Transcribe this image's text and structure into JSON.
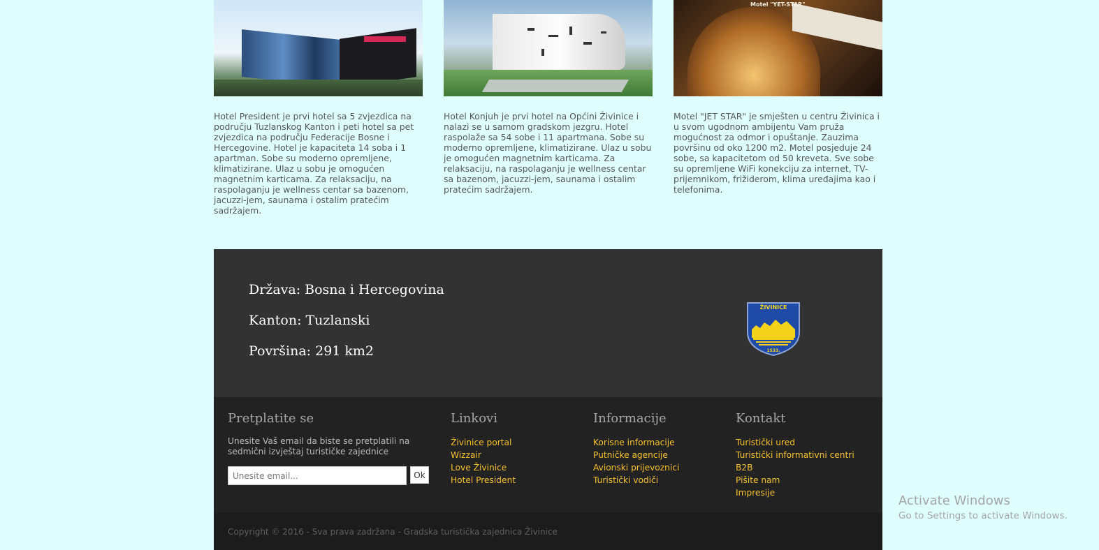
{
  "hotels": [
    {
      "image_alt": "Hotel President",
      "description": "Hotel President je prvi hotel sa 5 zvjezdica na području Tuzlanskog Kanton i peti hotel sa pet zvjezdica na području Federacije Bosne i Hercegovine. Hotel je kapaciteta 14 soba i 1 apartman. Sobe su moderno opremljene, klimatizirane. Ulaz u sobu je omogućen magnetnim karticama. Za relaksaciju, na raspolaganju je wellness centar sa bazenom, jacuzzi-jem, saunama i ostalim pratećim sadržajem."
    },
    {
      "image_alt": "Hotel Konjuh",
      "description": "Hotel Konjuh je prvi hotel na Općini Živinice i nalazi se u samom gradskom jezgru. Hotel raspolaže sa 54 sobe i 11 apartmana. Sobe su moderno opremljene, klimatizirane. Ulaz u sobu je omogućen magnetnim karticama. Za relaksaciju, na raspolaganju je wellness centar sa bazenom, jacuzzi-jem, saunama i ostalim pratećim sadržajem."
    },
    {
      "image_alt": "Motel Jet Star",
      "image_sign": "Motel \"YET-STAR\"",
      "description": "Motel \"JET STAR\" je smješten u centru Živinica i u svom ugodnom ambijentu Vam pruža mogućnost za odmor i opuštanje. Zauzima površinu od oko 1200 m2. Motel posjeduje 24 sobe, sa kapacitetom od 50 kreveta. Sve sobe su opremljene WiFi konekciju za internet, TV-prijemnikom, frižiderom, klima uređajima kao i telefonima."
    }
  ],
  "info": {
    "country": "Država: Bosna i Hercegovina",
    "canton": "Kanton: Tuzlanski",
    "area": "Površina: 291 km2",
    "crest_title": "ŽIVINICE",
    "crest_year": "1533."
  },
  "footer": {
    "subscribe": {
      "title": "Pretplatite se",
      "description": "Unesite Vaš email da biste se pretplatili na sedmični izvještaj turističke zajednice",
      "email_placeholder": "Unesite email...",
      "button_label": "Ok"
    },
    "links": {
      "title": "Linkovi",
      "items": [
        "Živinice portal",
        "Wizzair",
        "Love Živinice",
        "Hotel President"
      ]
    },
    "information": {
      "title": "Informacije",
      "items": [
        "Korisne informacije",
        "Putničke agencije",
        "Avionski prijevoznici",
        "Turistički vodiči"
      ]
    },
    "contact": {
      "title": "Kontakt",
      "items": [
        "Turistički ured",
        "Turistički informativni centri",
        "B2B",
        "Pišite nam",
        "Impresije"
      ]
    },
    "copyright": "Copyright © 2016 - Sva prava zadržana - Gradska turistička zajednica Živinice"
  },
  "watermark": {
    "line1": "Activate Windows",
    "line2": "Go to Settings to activate Windows."
  },
  "colors": {
    "page_bg": "#dfffff",
    "info_bg": "#323232",
    "footer_bg": "#222222",
    "link": "#f7c22e"
  }
}
